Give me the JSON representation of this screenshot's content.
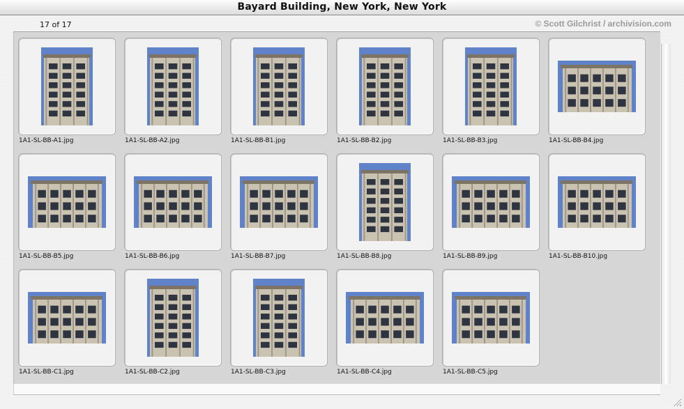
{
  "window": {
    "title": "Bayard Building, New York, New York",
    "count": "17 of 17",
    "credit": "© Scott Gilchrist / archivision.com"
  },
  "thumbnails": [
    {
      "file": "1A1-SL-BB-A1.jpg",
      "orientation": "portrait"
    },
    {
      "file": "1A1-SL-BB-A2.jpg",
      "orientation": "portrait"
    },
    {
      "file": "1A1-SL-BB-B1.jpg",
      "orientation": "portrait"
    },
    {
      "file": "1A1-SL-BB-B2.jpg",
      "orientation": "portrait"
    },
    {
      "file": "1A1-SL-BB-B3.jpg",
      "orientation": "portrait"
    },
    {
      "file": "1A1-SL-BB-B4.jpg",
      "orientation": "landscape"
    },
    {
      "file": "1A1-SL-BB-B5.jpg",
      "orientation": "landscape"
    },
    {
      "file": "1A1-SL-BB-B6.jpg",
      "orientation": "landscape"
    },
    {
      "file": "1A1-SL-BB-B7.jpg",
      "orientation": "landscape"
    },
    {
      "file": "1A1-SL-BB-B8.jpg",
      "orientation": "portrait"
    },
    {
      "file": "1A1-SL-BB-B9.jpg",
      "orientation": "landscape"
    },
    {
      "file": "1A1-SL-BB-B10.jpg",
      "orientation": "landscape"
    },
    {
      "file": "1A1-SL-BB-C1.jpg",
      "orientation": "landscape"
    },
    {
      "file": "1A1-SL-BB-C2.jpg",
      "orientation": "portrait"
    },
    {
      "file": "1A1-SL-BB-C3.jpg",
      "orientation": "portrait"
    },
    {
      "file": "1A1-SL-BB-C4.jpg",
      "orientation": "landscape"
    },
    {
      "file": "1A1-SL-BB-C5.jpg",
      "orientation": "landscape"
    }
  ],
  "colors": {
    "sky": "#5f82c9",
    "stone": "#cbc3b2",
    "stone_dark": "#7d7466",
    "window": "#2e3440",
    "slide_bg": "#f2f2f2",
    "panel_bg": "#d6d6d6",
    "credit_text": "#9a9a9a"
  }
}
